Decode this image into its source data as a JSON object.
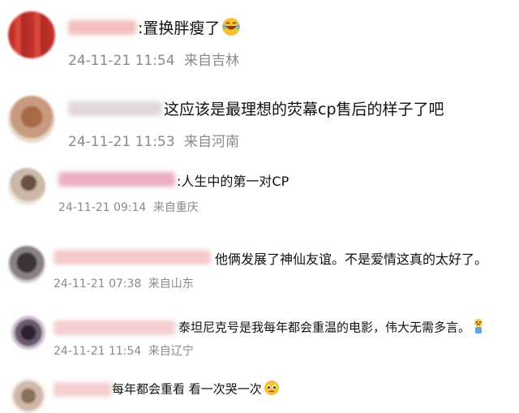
{
  "comments": [
    {
      "text": ":置换胖瘦了",
      "emoji": "laughing-tears",
      "time": "24-11-21 11:54",
      "location": "来自吉林"
    },
    {
      "text": "这应该是最理想的荧幕cp售后的样子了吧",
      "time": "24-11-21 11:53",
      "location": "来自河南"
    },
    {
      "text": ":人生中的第一对CP",
      "time": "24-11-21 09:14",
      "location": "来自重庆"
    },
    {
      "text": "他俩发展了神仙友谊。不是爱情这真的太好了。",
      "time": "24-11-21 07:38",
      "location": "来自山东"
    },
    {
      "text": "泰坦尼克号是我每年都会重温的电影，伟大无需多言。",
      "emoji": "crying-figure",
      "time": "24-11-21 11:54",
      "location": "来自辽宁"
    },
    {
      "text": "每年都会重看 看一次哭一次",
      "emoji": "teary-face",
      "time": "",
      "location": ""
    }
  ],
  "colors": {
    "text": "#111111",
    "meta": "#8a8a8a",
    "background": "#ffffff"
  }
}
